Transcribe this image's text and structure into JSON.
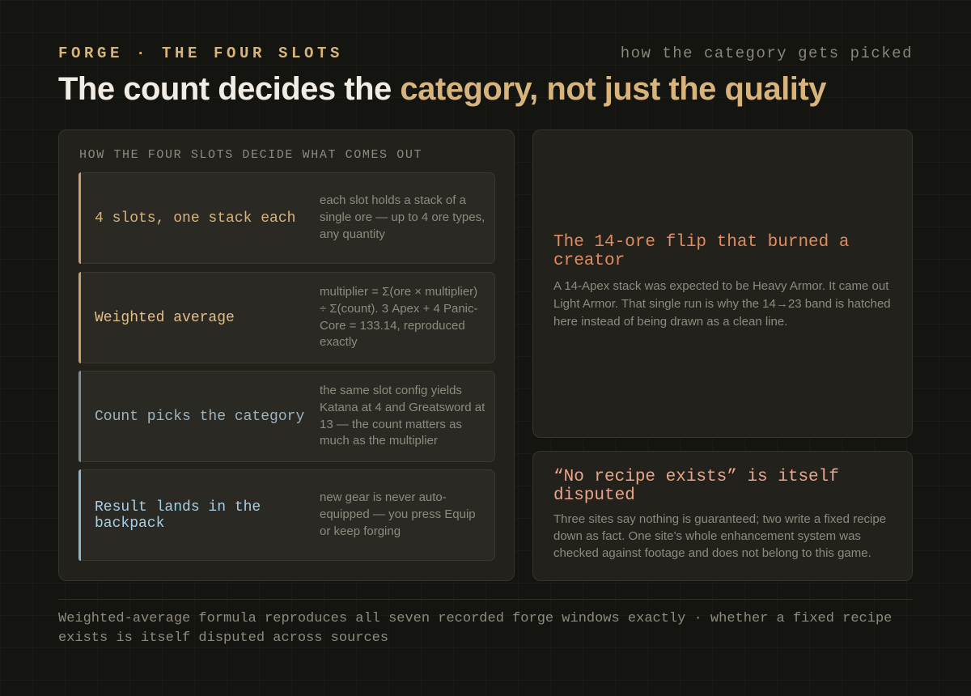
{
  "header": {
    "eyebrow": "FORGE · THE FOUR SLOTS",
    "eyebrow_right": "how the category gets picked",
    "title_plain": "The count decides the ",
    "title_accent": "category, not just the quality"
  },
  "slots_panel": {
    "label": "HOW THE FOUR SLOTS DECIDE WHAT COMES OUT",
    "rows": [
      {
        "title": "4 slots, one stack each",
        "description": "each slot holds a stack of a single ore — up to 4 ore types, any quantity",
        "bar_color": "#c9a06a",
        "title_color": "#d8b47d"
      },
      {
        "title": "Weighted average",
        "description": "multiplier = Σ(ore × multiplier) ÷ Σ(count). 3 Apex + 4 Panic-Core = 133.14, reproduced exactly",
        "bar_color": "#c9a06a",
        "title_color": "#e3be86"
      },
      {
        "title": "Count picks the category",
        "description": "the same slot config yields Katana at 4 and Greatsword at 13 — the count matters as much as the multiplier",
        "bar_color": "#7e8d96",
        "title_color": "#9fb3bf"
      },
      {
        "title": "Result lands in the backpack",
        "description": "new gear is never auto-equipped — you press Equip or keep forging",
        "bar_color": "#8cb6cf",
        "title_color": "#a6d0e6"
      }
    ]
  },
  "card_flip": {
    "title": "The 14-ore flip that burned a creator",
    "body": "A 14-Apex stack was expected to be Heavy Armor. It came out Light Armor. That single run is why the 14→23 band is hatched here instead of being drawn as a clean line.",
    "title_color": "#e08c5e"
  },
  "card_recipe": {
    "title": "“No recipe exists” is itself disputed",
    "body": "Three sites say nothing is guaranteed; two write a fixed recipe down as fact. One site’s whole enhancement system was checked against footage and does not belong to this game.",
    "title_color": "#eba58a"
  },
  "footer": {
    "text": "Weighted-average formula reproduces all seven recorded forge windows exactly · whether a fixed recipe exists is itself disputed across sources"
  }
}
